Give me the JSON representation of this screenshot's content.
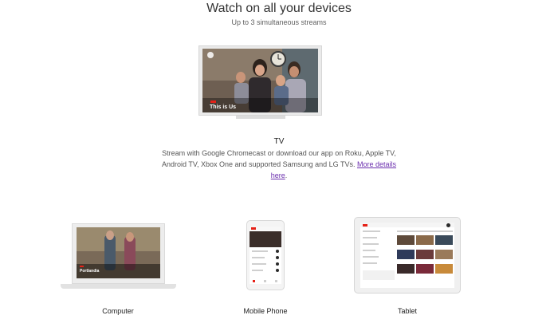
{
  "header": {
    "title": "Watch on all your devices",
    "subtitle": "Up to 3 simultaneous streams"
  },
  "tv": {
    "show_title": "This is Us",
    "label": "TV",
    "description": "Stream with Google Chromecast or download our app on Roku, Apple TV, Android TV, Xbox One and supported Samsung and LG TVs.",
    "link_text": "More details here",
    "after_link": "."
  },
  "computer": {
    "label": "Computer",
    "show_title": "Portlandia"
  },
  "phone": {
    "label": "Mobile Phone"
  },
  "tablet": {
    "label": "Tablet"
  },
  "colors": {
    "accent_red": "#e62117",
    "link_purple": "#6b2fae"
  }
}
